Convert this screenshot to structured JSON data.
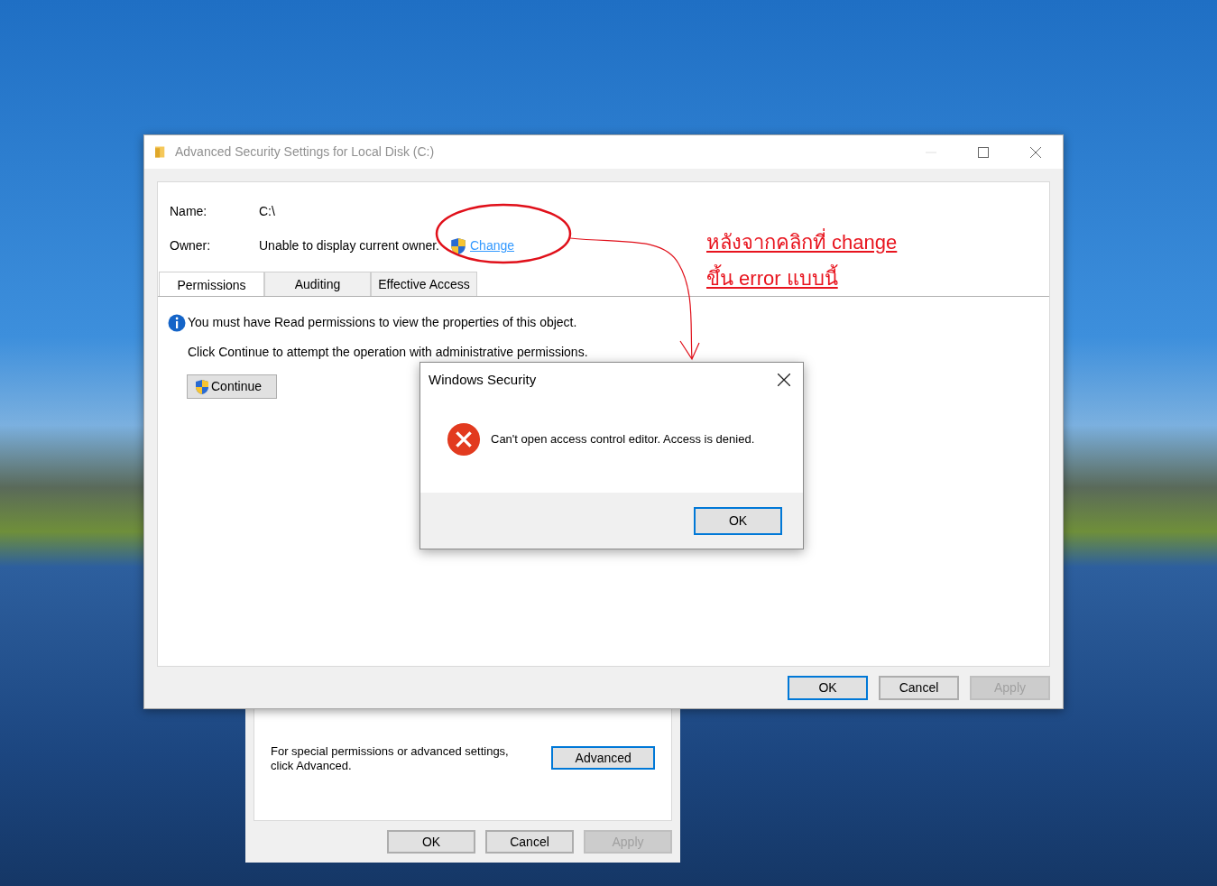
{
  "back_window": {
    "note": "For special permissions or advanced settings, click Advanced.",
    "advanced_button": {
      "label": "Advanced",
      "focused": true,
      "disabled": false
    },
    "buttons": [
      {
        "label": "OK",
        "focused": false,
        "disabled": false
      },
      {
        "label": "Cancel",
        "focused": false,
        "disabled": false
      },
      {
        "label": "Apply",
        "focused": false,
        "disabled": true
      }
    ]
  },
  "main_window": {
    "title": "Advanced Security Settings for Local Disk (C:)",
    "name_label": "Name:",
    "name_value": "C:\\",
    "owner_label": "Owner:",
    "owner_value": "Unable to display current owner.",
    "change_link": "Change",
    "tabs": [
      {
        "label": "Permissions",
        "selected": true
      },
      {
        "label": "Auditing",
        "selected": false
      },
      {
        "label": "Effective Access",
        "selected": false
      }
    ],
    "info_message": "You must have Read permissions to view the properties of this object.",
    "continue_hint": "Click Continue to attempt the operation with administrative permissions.",
    "continue_button": "Continue",
    "buttons": [
      {
        "label": "OK",
        "focused": true,
        "disabled": false
      },
      {
        "label": "Cancel",
        "focused": false,
        "disabled": false
      },
      {
        "label": "Apply",
        "focused": false,
        "disabled": true
      }
    ]
  },
  "dialog": {
    "title": "Windows Security",
    "message": "Can't open access control editor. Access is denied.",
    "ok_button": {
      "label": "OK",
      "focused": true,
      "disabled": false
    }
  },
  "annotation": {
    "lines": [
      "หลังจากคลิกที่ change",
      "ขึ้น error แบบนี้"
    ]
  }
}
